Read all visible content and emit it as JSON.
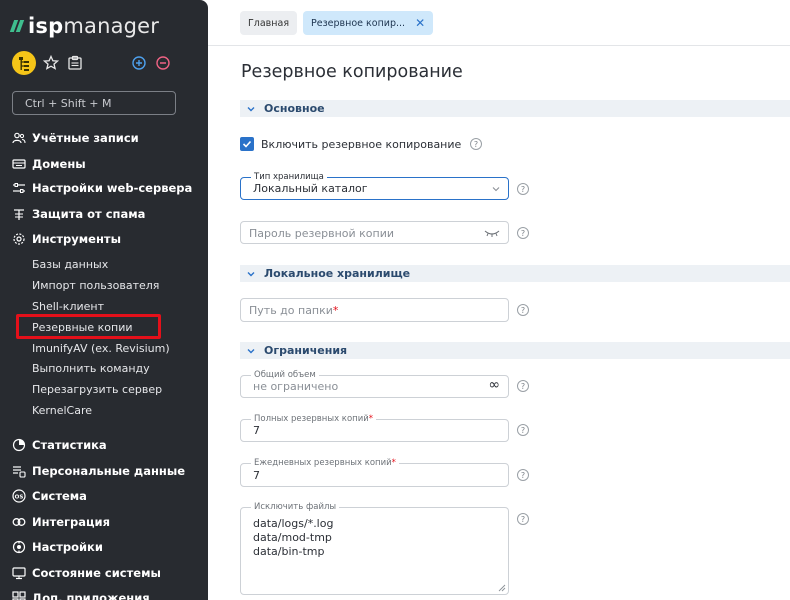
{
  "app": {
    "logo_bold": "isp",
    "logo_light": "manager"
  },
  "toolbar": {
    "shortcut_placeholder": "Ctrl + Shift + M"
  },
  "sidebar": {
    "items": [
      {
        "label": "Учётные записи",
        "icon": "users-icon"
      },
      {
        "label": "Домены",
        "icon": "domains-icon"
      },
      {
        "label": "Настройки web-сервера",
        "icon": "sliders-icon"
      },
      {
        "label": "Защита от спама",
        "icon": "shield-icon"
      },
      {
        "label": "Инструменты",
        "icon": "gear-icon"
      }
    ],
    "subitems": [
      "Базы данных",
      "Импорт пользователя",
      "Shell-клиент",
      "Резервные копии",
      "ImunifyAV (ex. Revisium)",
      "Выполнить команду",
      "Перезагрузить сервер",
      "KernelCare"
    ],
    "items2": [
      {
        "label": "Статистика",
        "icon": "pie-chart-icon"
      },
      {
        "label": "Персональные данные",
        "icon": "personal-data-icon"
      },
      {
        "label": "Система",
        "icon": "os-icon"
      },
      {
        "label": "Интеграция",
        "icon": "link-icon"
      },
      {
        "label": "Настройки",
        "icon": "settings-icon"
      },
      {
        "label": "Состояние системы",
        "icon": "monitor-icon"
      },
      {
        "label": "Доп. приложения",
        "icon": "apps-icon"
      }
    ]
  },
  "breadcrumbs": {
    "home": "Главная",
    "current": "Резервное копир..."
  },
  "page": {
    "title": "Резервное копирование"
  },
  "sections": {
    "main": "Основное",
    "local": "Локальное хранилище",
    "limits": "Ограничения"
  },
  "form": {
    "enable_backup_label": "Включить резервное копирование",
    "enable_backup_checked": true,
    "storage_type_label": "Тип хранилища",
    "storage_type_value": "Локальный каталог",
    "password_placeholder": "Пароль резервной копии",
    "folder_path_placeholder": "Путь до папки",
    "total_volume_label": "Общий объем",
    "total_volume_value": "не ограничено",
    "full_copies_label": "Полных резервных копий",
    "full_copies_value": "7",
    "daily_copies_label": "Ежедневных резервных копий",
    "daily_copies_value": "7",
    "exclude_files_label": "Исключить файлы",
    "exclude_files_lines": [
      "data/logs/*.log",
      "data/mod-tmp",
      "data/bin-tmp"
    ],
    "help_glyph": "?",
    "required_mark": "*",
    "close_glyph": "✕",
    "infinity_glyph": "∞"
  },
  "colors": {
    "sidebar_bg": "#282b30",
    "accent": "#2a72c9",
    "logo_green": "#3fbf8e",
    "highlight_red": "#e4101a"
  }
}
